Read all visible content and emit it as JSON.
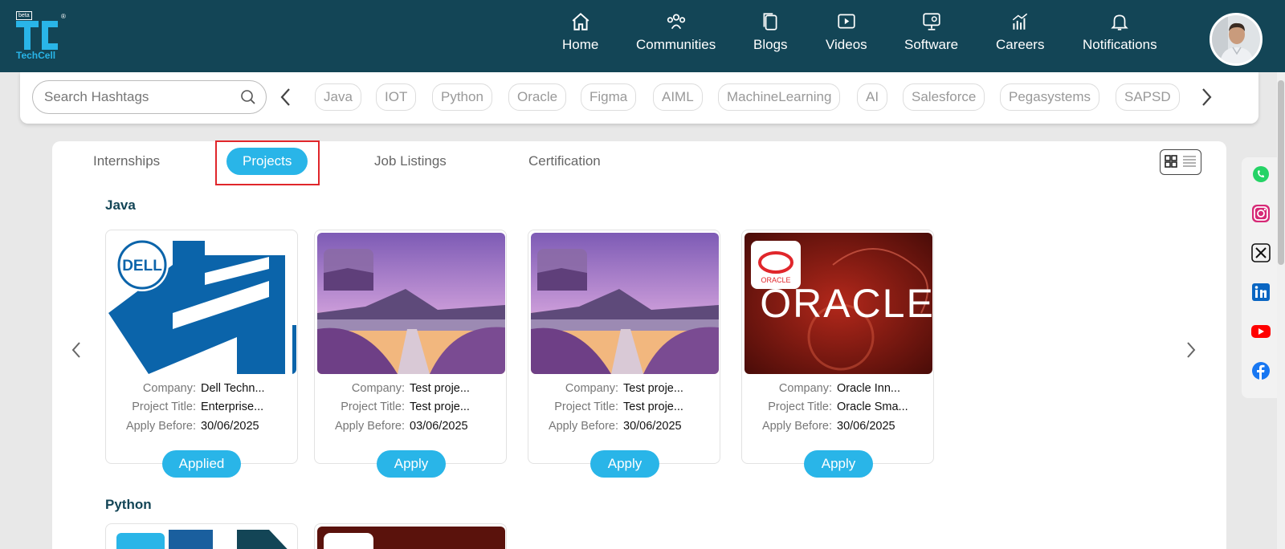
{
  "brand": {
    "name": "TechCell",
    "beta": "beta",
    "reg": "®"
  },
  "nav": [
    {
      "label": "Home",
      "icon": "home-icon"
    },
    {
      "label": "Communities",
      "icon": "communities-icon"
    },
    {
      "label": "Blogs",
      "icon": "blogs-icon"
    },
    {
      "label": "Videos",
      "icon": "videos-icon"
    },
    {
      "label": "Software",
      "icon": "software-icon"
    },
    {
      "label": "Careers",
      "icon": "careers-icon"
    },
    {
      "label": "Notifications",
      "icon": "bell-icon"
    }
  ],
  "search": {
    "placeholder": "Search Hashtags"
  },
  "hashtags": [
    "Java",
    "IOT",
    "Python",
    "Oracle",
    "Figma",
    "AIML",
    "MachineLearning",
    "AI",
    "Salesforce",
    "Pegasystems",
    "SAPSD"
  ],
  "tabs": [
    "Internships",
    "Projects",
    "Job Listings",
    "Certification"
  ],
  "active_tab": "Projects",
  "labels": {
    "company": "Company:",
    "title": "Project Title:",
    "apply_before": "Apply Before:"
  },
  "sections": [
    {
      "title": "Java",
      "cards": [
        {
          "company": "Dell Techn...",
          "title": "Enterprise...",
          "apply_before": "30/06/2025",
          "button": "Applied",
          "thumb": "dell"
        },
        {
          "company": "Test proje...",
          "title": "Test proje...",
          "apply_before": "03/06/2025",
          "button": "Apply",
          "thumb": "landscape"
        },
        {
          "company": "Test proje...",
          "title": "Test proje...",
          "apply_before": "30/06/2025",
          "button": "Apply",
          "thumb": "landscape"
        },
        {
          "company": "Oracle Inn...",
          "title": "Oracle Sma...",
          "apply_before": "30/06/2025",
          "button": "Apply",
          "thumb": "oracle"
        }
      ]
    },
    {
      "title": "Python"
    }
  ],
  "thumb_text": {
    "dell": "DELL",
    "oracle_small": "ORACLE",
    "oracle_big": "ORACLE"
  },
  "social": [
    "whatsapp-icon",
    "instagram-icon",
    "x-icon",
    "linkedin-icon",
    "youtube-icon",
    "facebook-icon"
  ],
  "colors": {
    "navbar": "#134556",
    "accent": "#29b5e8",
    "highlight": "#e0262b"
  }
}
